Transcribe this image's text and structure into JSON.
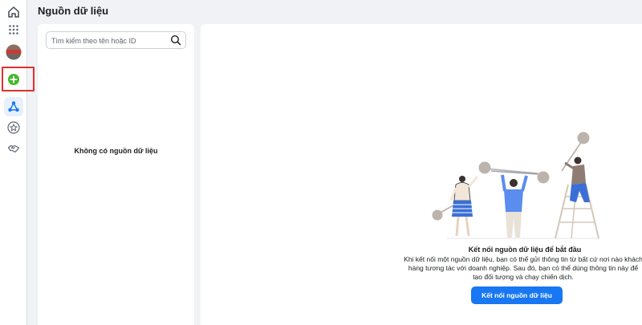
{
  "nav": {
    "items": [
      {
        "id": "home",
        "icon": "home-icon"
      },
      {
        "id": "apps",
        "icon": "grid-icon"
      },
      {
        "id": "account",
        "icon": "avatar"
      },
      {
        "id": "add",
        "icon": "plus-circle-icon"
      },
      {
        "id": "data-sources",
        "icon": "network-icon"
      },
      {
        "id": "favorites",
        "icon": "star-icon"
      },
      {
        "id": "partners",
        "icon": "handshake-icon"
      }
    ],
    "colors": {
      "accent": "#1877f2",
      "add": "#42b72a",
      "highlight": "#e0302c"
    }
  },
  "header": {
    "title": "Nguồn dữ liệu"
  },
  "sidebar": {
    "search_placeholder": "Tìm kiếm theo tên hoặc ID",
    "empty_label": "Không có nguồn dữ liệu"
  },
  "main": {
    "title": "Kết nối nguồn dữ liệu để bắt đầu",
    "description": "Khi kết nối một nguồn dữ liệu, bạn có thể gửi thông tin từ bất cứ nơi nào khách hàng tương tác với doanh nghiệp. Sau đó, bạn có thể dùng thông tin này để tạo đối tượng và chạy chiến dịch.",
    "button_label": "Kết nối nguồn dữ liệu"
  }
}
